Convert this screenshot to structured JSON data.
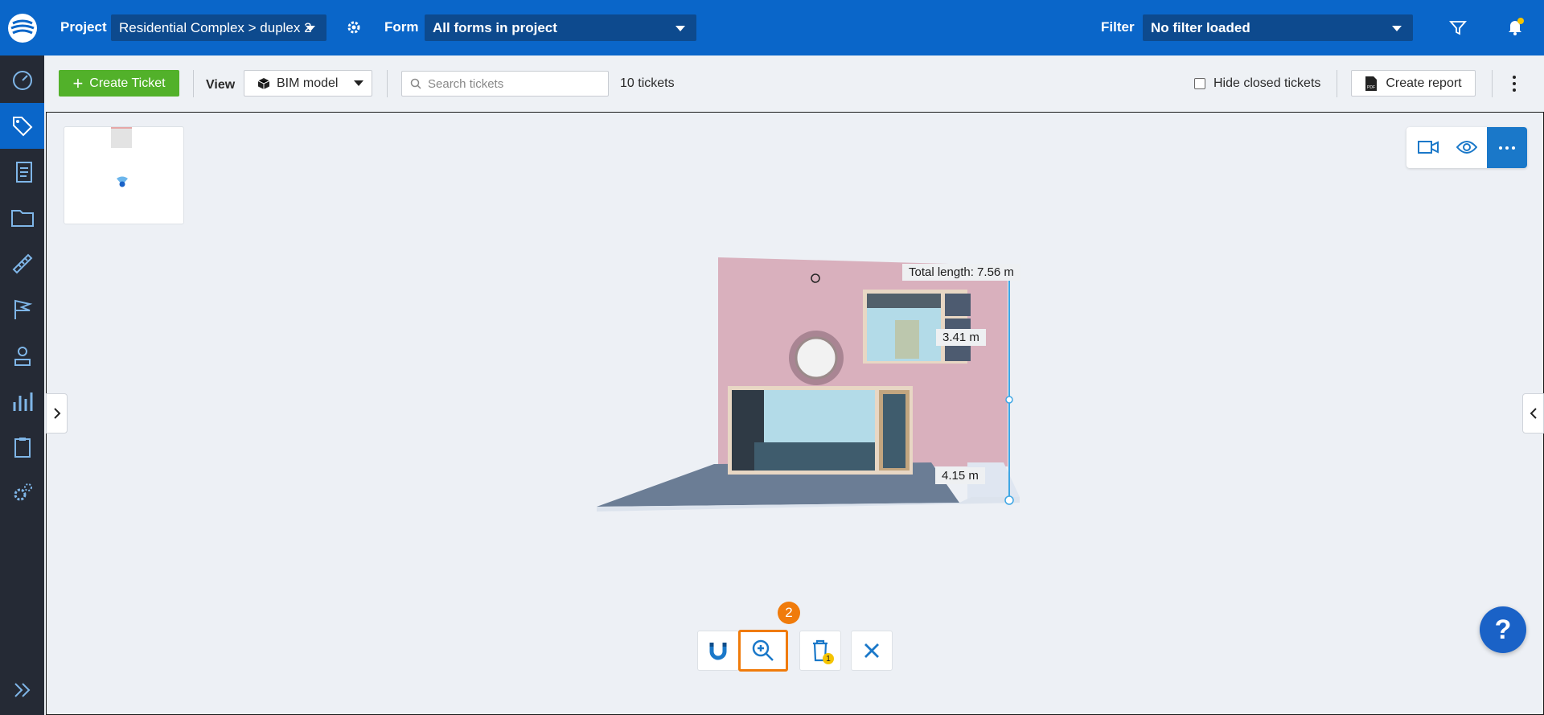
{
  "topbar": {
    "project_label": "Project",
    "project_value": "Residential Complex > duplex 2",
    "form_label": "Form",
    "form_value": "All forms in project",
    "filter_label": "Filter",
    "filter_value": "No filter loaded"
  },
  "sidebar": {
    "items": [
      "dashboard-icon",
      "tag-icon",
      "forms-icon",
      "folder-icon",
      "ruler-icon",
      "flag-icon",
      "person-icon",
      "chart-icon",
      "clipboard-icon",
      "settings-icon",
      "expand-icon"
    ],
    "active_index": 1
  },
  "toolbar": {
    "create_label": "Create Ticket",
    "view_label": "View",
    "view_value": "BIM model",
    "search_placeholder": "Search tickets",
    "ticket_count": "10 tickets",
    "hide_closed_label": "Hide closed tickets",
    "report_label": "Create report"
  },
  "viewer": {
    "total_length": "Total length: 7.56 m",
    "segment_top": "3.41 m",
    "segment_bottom": "4.15 m",
    "step_badge": "2",
    "trash_badge": "1",
    "help_label": "?"
  },
  "colors": {
    "brand": "#0a66c9",
    "create": "#52b12a",
    "highlight": "#f07b0b",
    "sidebar": "#252a35"
  }
}
